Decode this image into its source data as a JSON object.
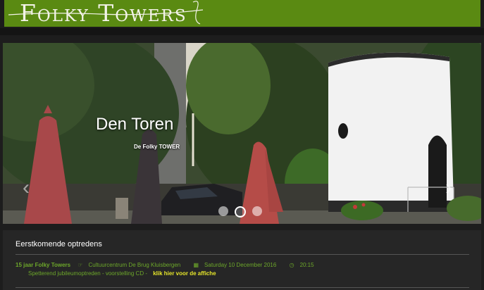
{
  "site": {
    "logo_text": "Folky Towers"
  },
  "slider": {
    "caption_title": "Den Toren",
    "caption_subtitle": "De Folky TOWER",
    "prev_label": "‹",
    "next_label": "›",
    "slide_count": 3,
    "active_slide": 2
  },
  "events": {
    "section_title": "Eerstkomende optredens",
    "items": [
      {
        "name": "15 jaar Folky Towers",
        "venue": "Cultuurcentrum De Brug Kluisbergen",
        "date": "Saturday 10 December 2016",
        "time": "20:15",
        "description": "Spetterend jubileumoptreden - voorstelling CD -",
        "link_text": "klik hier voor de affiche"
      }
    ]
  },
  "colors": {
    "brand_green": "#5a8a12",
    "event_green": "#6da82a",
    "link_yellow": "#e6e62a"
  },
  "icons": [
    "venue-icon",
    "calendar-icon",
    "clock-icon",
    "chevron-left-icon",
    "chevron-right-icon"
  ]
}
